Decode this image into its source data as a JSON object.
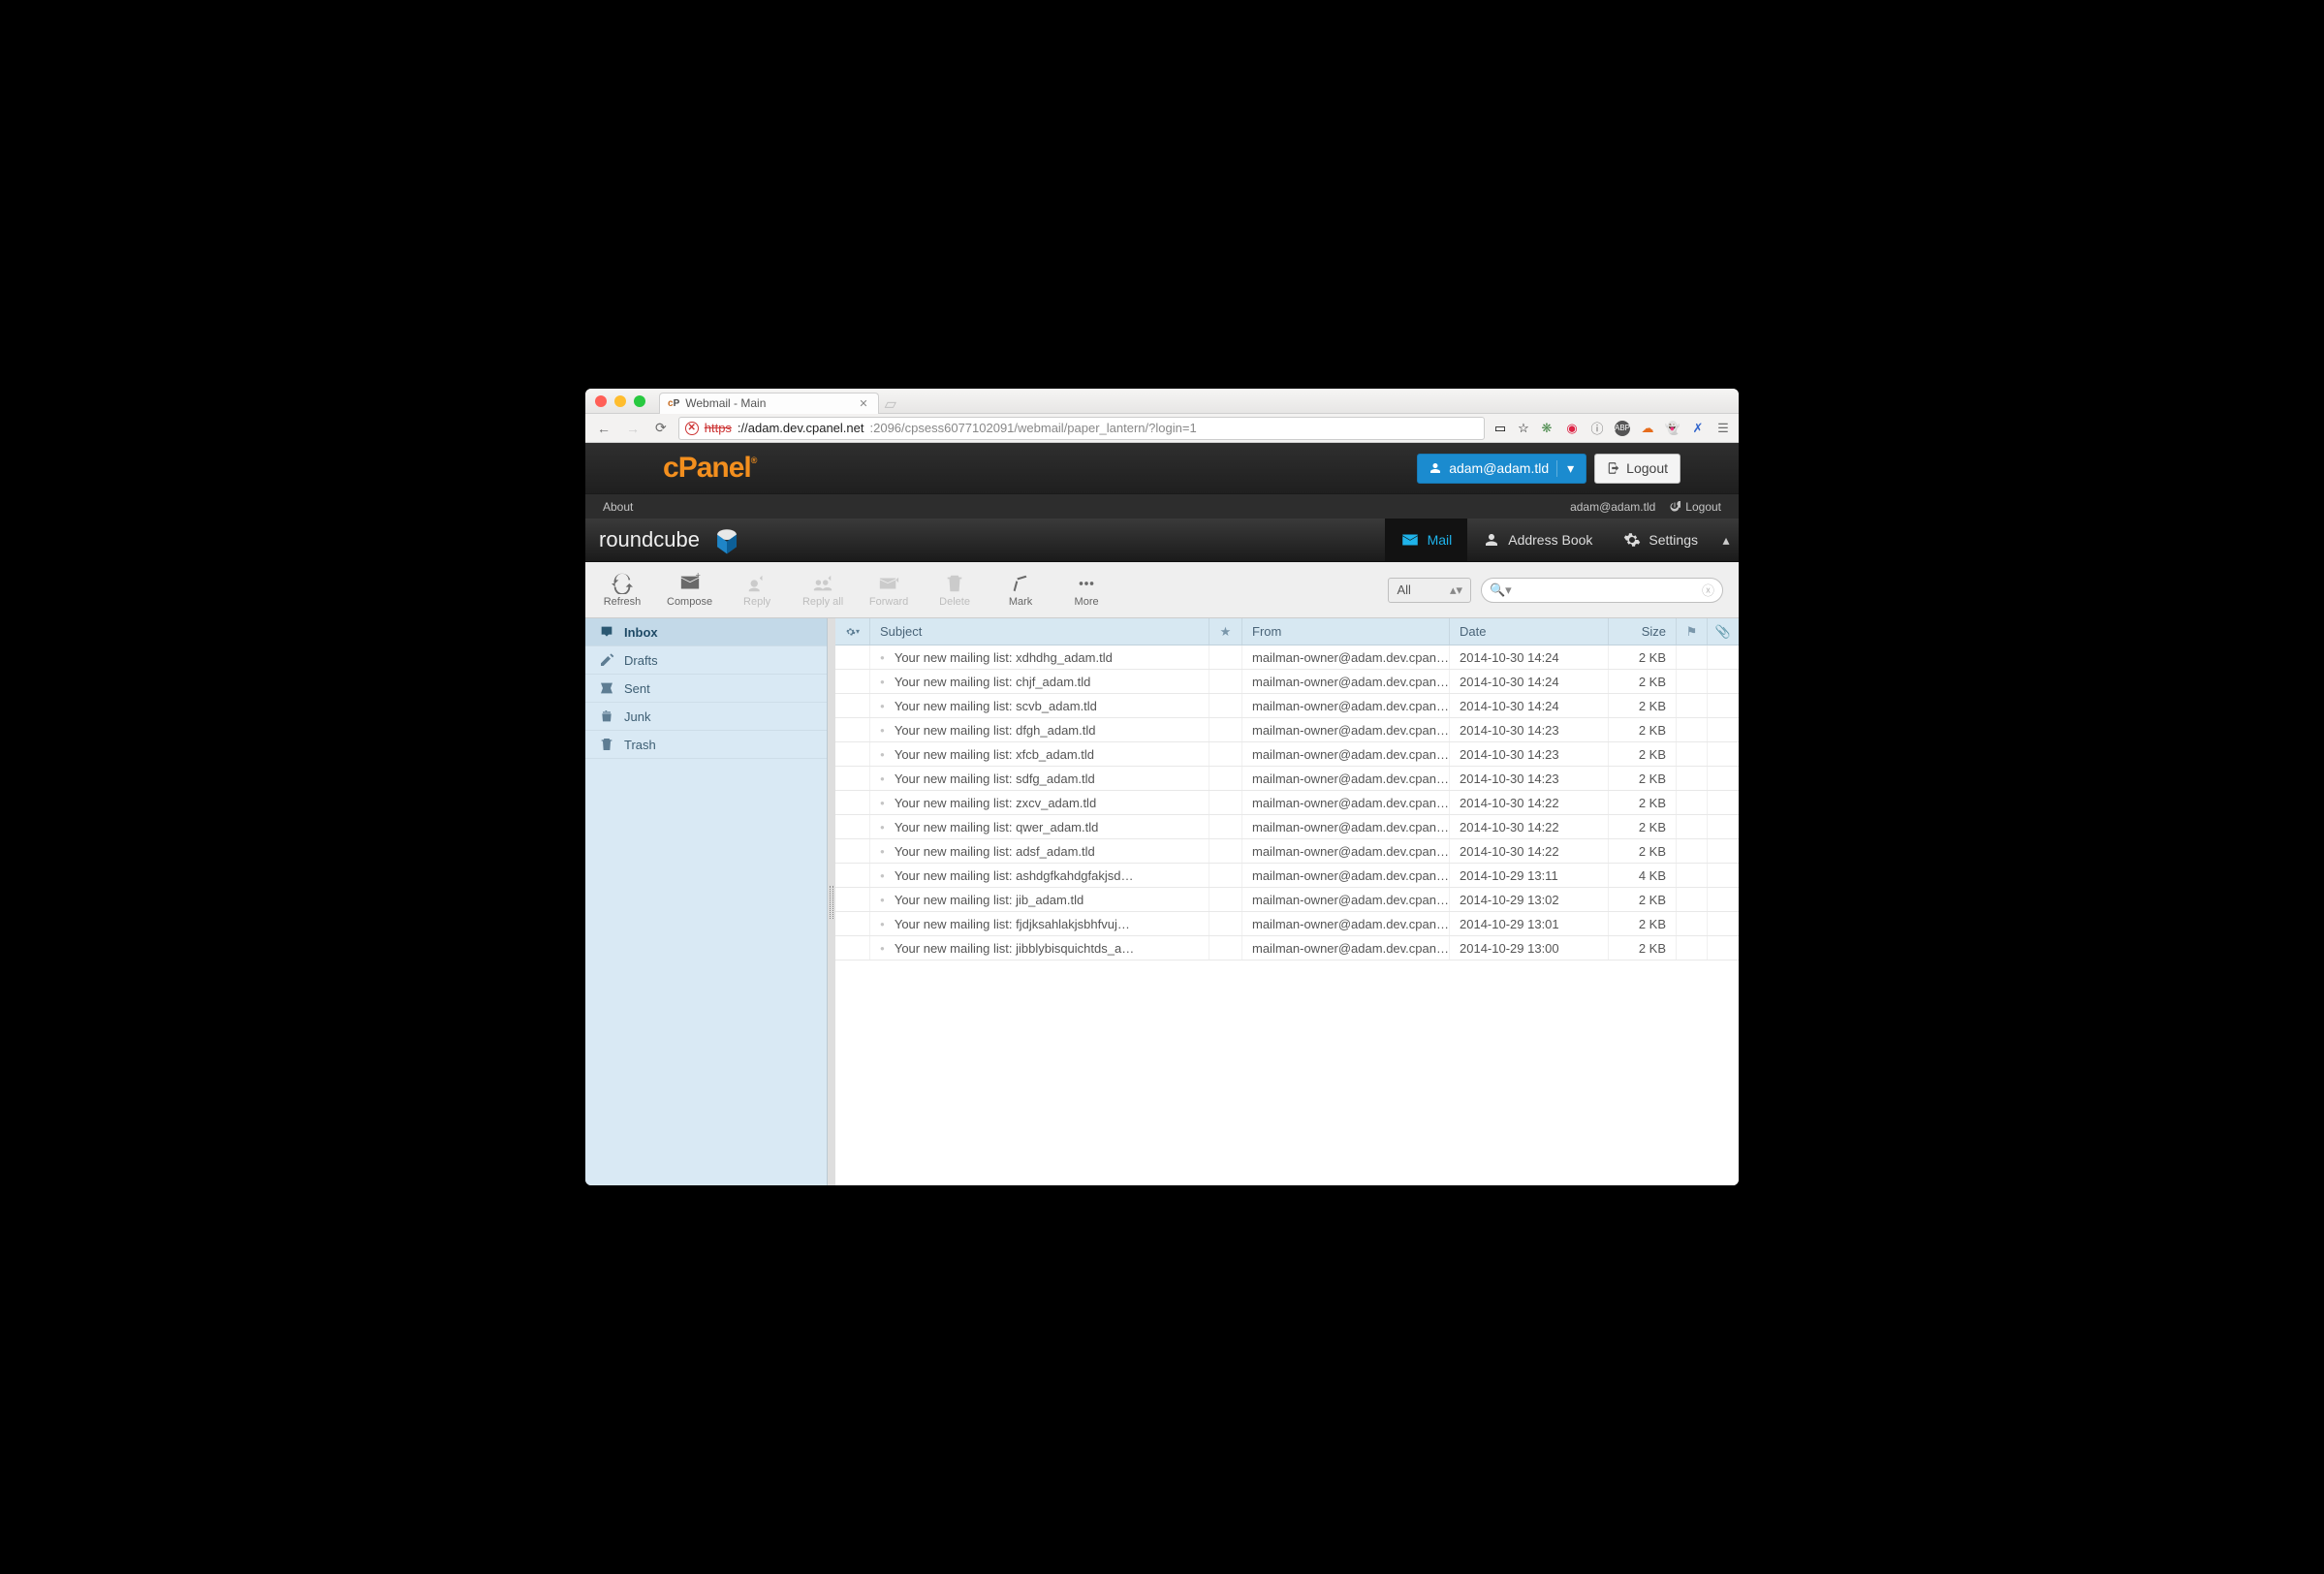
{
  "browser": {
    "tab_title": "Webmail - Main",
    "url_https": "https",
    "url_host": "://adam.dev.cpanel.net",
    "url_tail": ":2096/cpsess6077102091/webmail/paper_lantern/?login=1"
  },
  "cpanel": {
    "user": "adam@adam.tld",
    "logout": "Logout"
  },
  "rc_top": {
    "about": "About",
    "email": "adam@adam.tld",
    "logout": "Logout"
  },
  "rc_nav": {
    "brand": "roundcube",
    "mail": "Mail",
    "addressbook": "Address Book",
    "settings": "Settings"
  },
  "toolbar": {
    "refresh": "Refresh",
    "compose": "Compose",
    "reply": "Reply",
    "replyall": "Reply all",
    "forward": "Forward",
    "delete": "Delete",
    "mark": "Mark",
    "more": "More",
    "filter": "All"
  },
  "folders": {
    "inbox": "Inbox",
    "drafts": "Drafts",
    "sent": "Sent",
    "junk": "Junk",
    "trash": "Trash"
  },
  "columns": {
    "subject": "Subject",
    "from": "From",
    "date": "Date",
    "size": "Size"
  },
  "messages": [
    {
      "subject": "Your new mailing list: xdhdhg_adam.tld",
      "from": "mailman-owner@adam.dev.cpan…",
      "date": "2014-10-30 14:24",
      "size": "2 KB"
    },
    {
      "subject": "Your new mailing list: chjf_adam.tld",
      "from": "mailman-owner@adam.dev.cpan…",
      "date": "2014-10-30 14:24",
      "size": "2 KB"
    },
    {
      "subject": "Your new mailing list: scvb_adam.tld",
      "from": "mailman-owner@adam.dev.cpan…",
      "date": "2014-10-30 14:24",
      "size": "2 KB"
    },
    {
      "subject": "Your new mailing list: dfgh_adam.tld",
      "from": "mailman-owner@adam.dev.cpan…",
      "date": "2014-10-30 14:23",
      "size": "2 KB"
    },
    {
      "subject": "Your new mailing list: xfcb_adam.tld",
      "from": "mailman-owner@adam.dev.cpan…",
      "date": "2014-10-30 14:23",
      "size": "2 KB"
    },
    {
      "subject": "Your new mailing list: sdfg_adam.tld",
      "from": "mailman-owner@adam.dev.cpan…",
      "date": "2014-10-30 14:23",
      "size": "2 KB"
    },
    {
      "subject": "Your new mailing list: zxcv_adam.tld",
      "from": "mailman-owner@adam.dev.cpan…",
      "date": "2014-10-30 14:22",
      "size": "2 KB"
    },
    {
      "subject": "Your new mailing list: qwer_adam.tld",
      "from": "mailman-owner@adam.dev.cpan…",
      "date": "2014-10-30 14:22",
      "size": "2 KB"
    },
    {
      "subject": "Your new mailing list: adsf_adam.tld",
      "from": "mailman-owner@adam.dev.cpan…",
      "date": "2014-10-30 14:22",
      "size": "2 KB"
    },
    {
      "subject": "Your new mailing list: ashdgfkahdgfakjsd…",
      "from": "mailman-owner@adam.dev.cpan…",
      "date": "2014-10-29 13:11",
      "size": "4 KB"
    },
    {
      "subject": "Your new mailing list: jib_adam.tld",
      "from": "mailman-owner@adam.dev.cpan…",
      "date": "2014-10-29 13:02",
      "size": "2 KB"
    },
    {
      "subject": "Your new mailing list: fjdjksahlakjsbhfvuj…",
      "from": "mailman-owner@adam.dev.cpan…",
      "date": "2014-10-29 13:01",
      "size": "2 KB"
    },
    {
      "subject": "Your new mailing list: jibblybisquichtds_a…",
      "from": "mailman-owner@adam.dev.cpan…",
      "date": "2014-10-29 13:00",
      "size": "2 KB"
    }
  ]
}
